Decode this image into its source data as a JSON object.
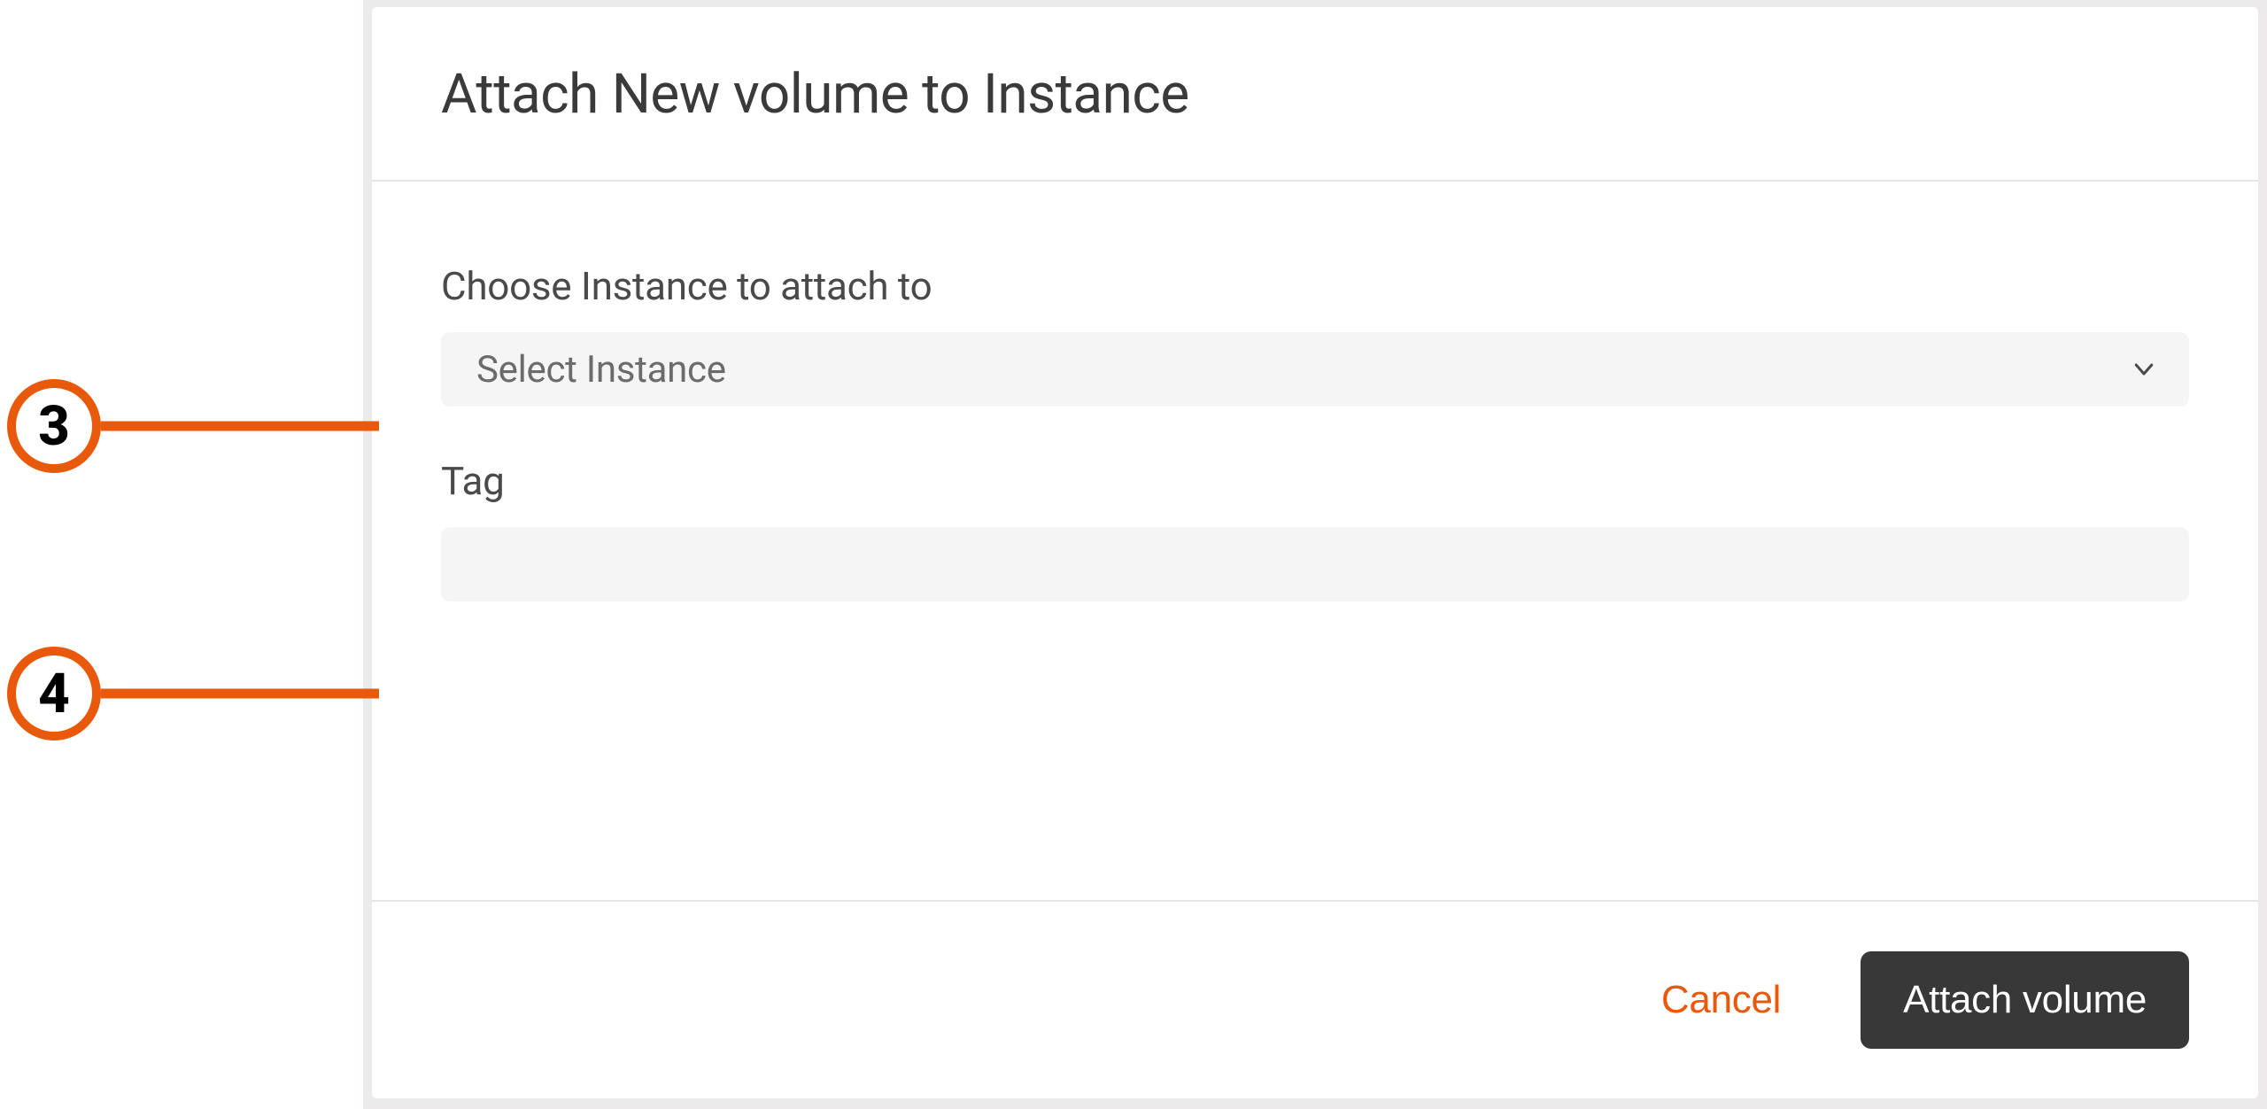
{
  "dialog": {
    "title": "Attach New volume to Instance",
    "instance": {
      "label": "Choose Instance to attach to",
      "placeholder": "Select Instance"
    },
    "tag": {
      "label": "Tag",
      "value": ""
    },
    "actions": {
      "cancel": "Cancel",
      "submit": "Attach volume"
    }
  },
  "callouts": {
    "step3": "3",
    "step4": "4"
  },
  "colors": {
    "accent": "#e8590c",
    "primaryButton": "#383838",
    "fieldBg": "#f5f5f5",
    "border": "#e6e6e6"
  }
}
